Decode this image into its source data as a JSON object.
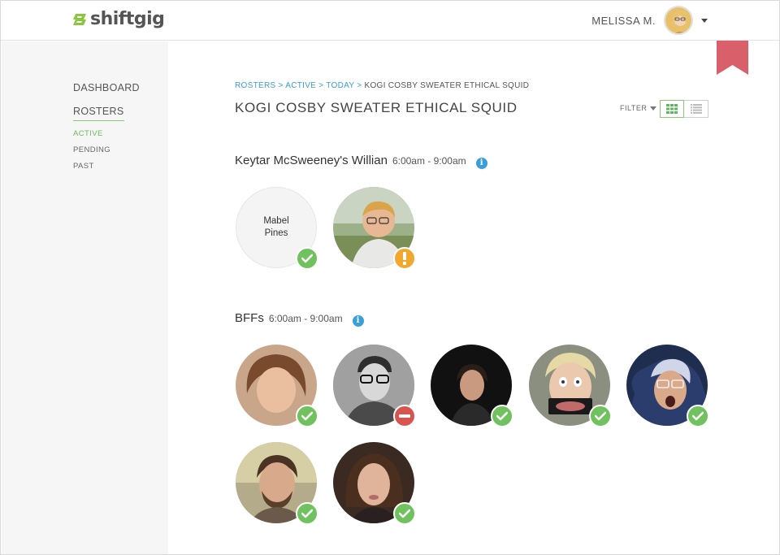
{
  "header": {
    "logo_text": "shiftgig",
    "user_name": "MELISSA M."
  },
  "sidebar": {
    "dashboard": "DASHBOARD",
    "rosters": "ROSTERS",
    "sub": {
      "active": "ACTIVE",
      "pending": "PENDING",
      "past": "PAST"
    }
  },
  "breadcrumb": {
    "items": [
      "ROSTERS",
      "ACTIVE",
      "TODAY"
    ],
    "separator": ">",
    "current": "KOGI COSBY SWEATER ETHICAL SQUID"
  },
  "page": {
    "title": "KOGI COSBY SWEATER ETHICAL SQUID",
    "filter_label": "FILTER"
  },
  "groups": [
    {
      "name": "Keytar McSweeney's Willian",
      "time": "6:00am - 9:00am",
      "people": [
        {
          "placeholder_line1": "Mabel",
          "placeholder_line2": "Pines",
          "status": "confirmed"
        },
        {
          "status": "warning"
        }
      ]
    },
    {
      "name": "BFFs",
      "time": "6:00am - 9:00am",
      "people": [
        {
          "status": "confirmed"
        },
        {
          "status": "declined"
        },
        {
          "status": "confirmed"
        },
        {
          "status": "confirmed"
        },
        {
          "status": "confirmed"
        },
        {
          "status": "confirmed"
        },
        {
          "status": "confirmed"
        }
      ]
    }
  ],
  "colors": {
    "brand_green": "#8cc63f",
    "link_blue": "#3a9fd6",
    "status_ok": "#6fc25e",
    "status_warn": "#f0a830",
    "status_block": "#d9534f",
    "bookmark": "#d9606a"
  },
  "icons": {
    "info": "i",
    "status_confirmed": "check-icon",
    "status_warning": "exclamation-icon",
    "status_declined": "minus-icon"
  }
}
